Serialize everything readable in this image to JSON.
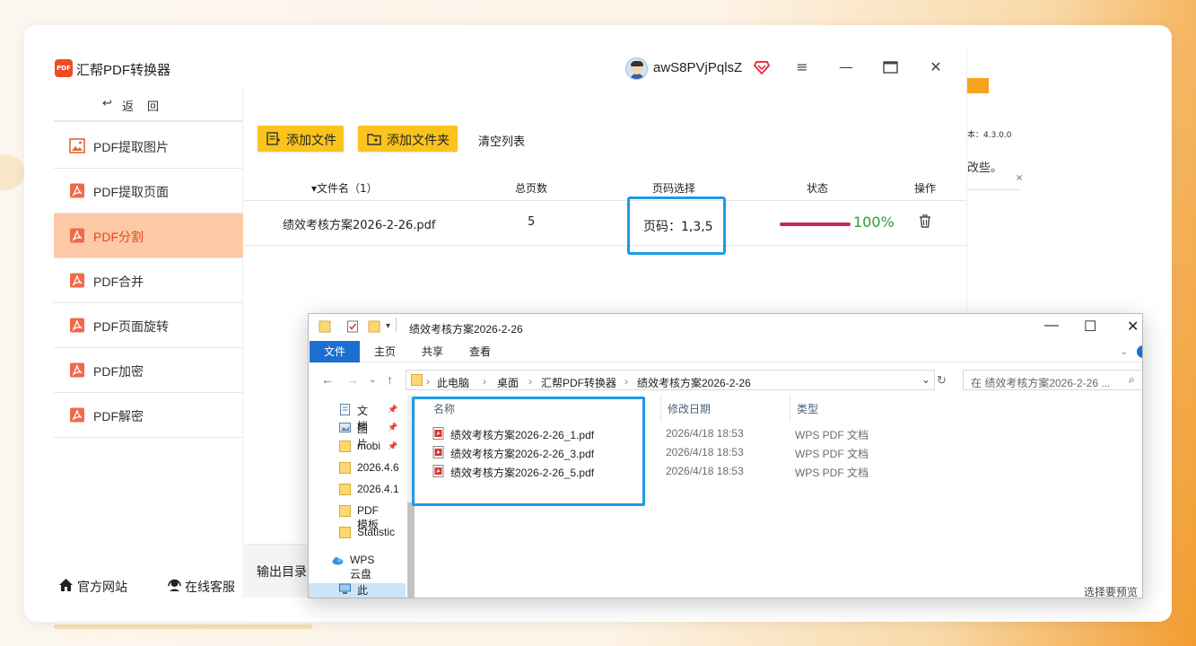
{
  "app": {
    "title": "汇帮PDF转换器",
    "logo_text": "PDF",
    "username": "awS8PVjPqlsZ",
    "accent_color": "#fbc41c",
    "active_color": "#e54818"
  },
  "right_strip": {
    "version_text": "本：4.3.0.0",
    "snippet_text": "改些。",
    "close_x": "×"
  },
  "sidebar": {
    "back_arrow": "↩",
    "back_label_1": "返",
    "back_label_2": "回",
    "items": [
      {
        "label": "PDF提取图片",
        "icon": "image-icon"
      },
      {
        "label": "PDF提取页面",
        "icon": "pdf-icon"
      },
      {
        "label": "PDF分割",
        "icon": "pdf-icon",
        "active": true
      },
      {
        "label": "PDF合并",
        "icon": "pdf-icon"
      },
      {
        "label": "PDF页面旋转",
        "icon": "pdf-icon"
      },
      {
        "label": "PDF加密",
        "icon": "pdf-icon"
      },
      {
        "label": "PDF解密",
        "icon": "pdf-icon"
      }
    ]
  },
  "bottom": {
    "website": "官方网站",
    "service": "在线客服"
  },
  "toolbar": {
    "add_file": "添加文件",
    "add_folder": "添加文件夹",
    "clear_list": "清空列表"
  },
  "table": {
    "columns": {
      "name": "▾文件名（1）",
      "pages": "总页数",
      "page_select": "页码选择",
      "status": "状态",
      "action": "操作"
    },
    "rows": [
      {
        "name": "绩效考核方案2026-2-26.pdf",
        "pages": "5",
        "page_select": "页码：1,3,5",
        "progress": 1.0,
        "percent": "100%"
      }
    ]
  },
  "output": {
    "label": "输出目录："
  },
  "explorer": {
    "title": "绩效考核方案2026-2-26",
    "minimize": "—",
    "maximize": "☐",
    "close": "✕",
    "tabs": {
      "file": "文件",
      "home": "主页",
      "share": "共享",
      "view": "查看"
    },
    "path": [
      "此电脑",
      "桌面",
      "汇帮PDF转换器",
      "绩效考核方案2026-2-26"
    ],
    "path_sep": "›",
    "search_placeholder": "在 绩效考核方案2026-2-26 ...",
    "tree": [
      {
        "label": "文档",
        "icon": "document-icon",
        "pinned": true
      },
      {
        "label": "图片",
        "icon": "picture-icon",
        "pinned": true
      },
      {
        "label": "mobi",
        "icon": "folder-icon",
        "pinned": true
      },
      {
        "label": "2026.4.6",
        "icon": "folder-icon"
      },
      {
        "label": "2026.4.1",
        "icon": "folder-icon"
      },
      {
        "label": "PDF模板",
        "icon": "folder-icon"
      },
      {
        "label": "Statistic",
        "icon": "folder-icon"
      },
      {
        "label": "WPS云盘",
        "icon": "cloud-icon"
      },
      {
        "label": "此电脑",
        "icon": "computer-icon"
      }
    ],
    "columns": {
      "name": "名称",
      "date": "修改日期",
      "type": "类型"
    },
    "files": [
      {
        "name": "绩效考核方案2026-2-26_1.pdf",
        "date": "2026/4/18 18:53",
        "type": "WPS PDF 文档"
      },
      {
        "name": "绩效考核方案2026-2-26_3.pdf",
        "date": "2026/4/18 18:53",
        "type": "WPS PDF 文档"
      },
      {
        "name": "绩效考核方案2026-2-26_5.pdf",
        "date": "2026/4/18 18:53",
        "type": "WPS PDF 文档"
      }
    ],
    "preview_text": "选择要预览的文件。"
  }
}
